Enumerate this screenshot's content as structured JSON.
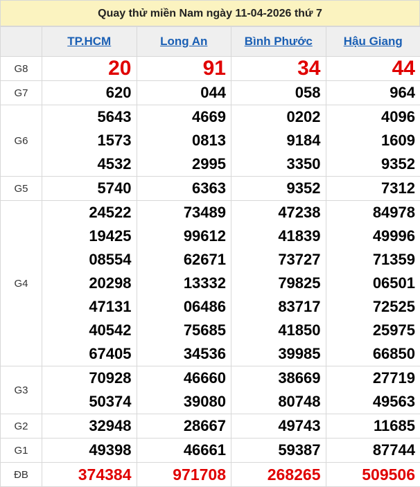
{
  "title": "Quay thử miền Nam ngày 11-04-2026 thứ 7",
  "provinces": [
    "TP.HCM",
    "Long An",
    "Bình Phước",
    "Hậu Giang"
  ],
  "colors": {
    "header_bg": "#fbf3c0",
    "link": "#1a5fb4",
    "highlight": "#e00000"
  },
  "rows": [
    {
      "label": "G8",
      "cls": "g8",
      "values": [
        [
          "20"
        ],
        [
          "91"
        ],
        [
          "34"
        ],
        [
          "44"
        ]
      ]
    },
    {
      "label": "G7",
      "cls": "",
      "values": [
        [
          "620"
        ],
        [
          "044"
        ],
        [
          "058"
        ],
        [
          "964"
        ]
      ]
    },
    {
      "label": "G6",
      "cls": "",
      "values": [
        [
          "5643",
          "1573",
          "4532"
        ],
        [
          "4669",
          "0813",
          "2995"
        ],
        [
          "0202",
          "9184",
          "3350"
        ],
        [
          "4096",
          "1609",
          "9352"
        ]
      ]
    },
    {
      "label": "G5",
      "cls": "",
      "values": [
        [
          "5740"
        ],
        [
          "6363"
        ],
        [
          "9352"
        ],
        [
          "7312"
        ]
      ]
    },
    {
      "label": "G4",
      "cls": "",
      "values": [
        [
          "24522",
          "19425",
          "08554",
          "20298",
          "47131",
          "40542",
          "67405"
        ],
        [
          "73489",
          "99612",
          "62671",
          "13332",
          "06486",
          "75685",
          "34536"
        ],
        [
          "47238",
          "41839",
          "73727",
          "79825",
          "83717",
          "41850",
          "39985"
        ],
        [
          "84978",
          "49996",
          "71359",
          "06501",
          "72525",
          "25975",
          "66850"
        ]
      ]
    },
    {
      "label": "G3",
      "cls": "",
      "values": [
        [
          "70928",
          "50374"
        ],
        [
          "46660",
          "39080"
        ],
        [
          "38669",
          "80748"
        ],
        [
          "27719",
          "49563"
        ]
      ]
    },
    {
      "label": "G2",
      "cls": "",
      "values": [
        [
          "32948"
        ],
        [
          "28667"
        ],
        [
          "49743"
        ],
        [
          "11685"
        ]
      ]
    },
    {
      "label": "G1",
      "cls": "",
      "values": [
        [
          "49398"
        ],
        [
          "46661"
        ],
        [
          "59387"
        ],
        [
          "87744"
        ]
      ]
    },
    {
      "label": "ĐB",
      "cls": "db",
      "values": [
        [
          "374384"
        ],
        [
          "971708"
        ],
        [
          "268265"
        ],
        [
          "509506"
        ]
      ]
    }
  ]
}
